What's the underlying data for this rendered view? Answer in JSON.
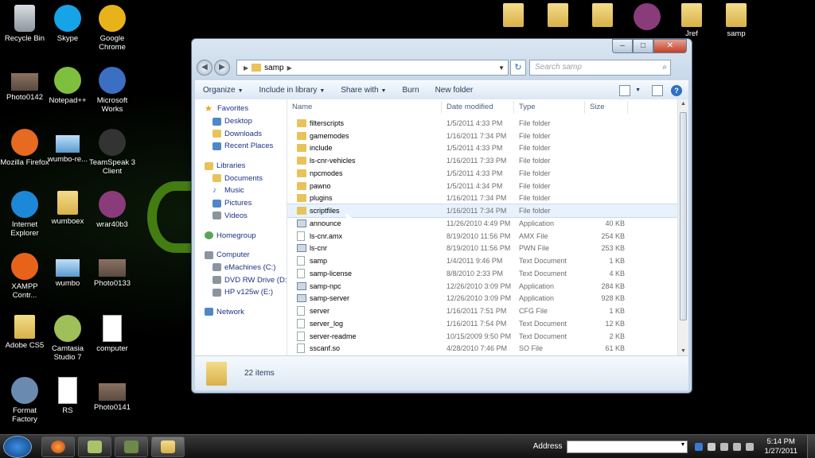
{
  "desktop": {
    "icons_left": [
      {
        "label": "Recycle Bin",
        "icon": "recycle-bin-icon"
      },
      {
        "label": "Skype",
        "icon": "skype-icon"
      },
      {
        "label": "Google Chrome",
        "icon": "chrome-icon"
      },
      {
        "label": "Photo0142",
        "icon": "photo-icon"
      },
      {
        "label": "Notepad++",
        "icon": "notepad-icon"
      },
      {
        "label": "Microsoft Works",
        "icon": "works-icon"
      },
      {
        "label": "Mozilla Firefox",
        "icon": "firefox-icon"
      },
      {
        "label": "wumbo-re...",
        "icon": "wumbo-icon"
      },
      {
        "label": "TeamSpeak 3 Client",
        "icon": "teamspeak-icon"
      },
      {
        "label": "Internet Explorer",
        "icon": "ie-icon"
      },
      {
        "label": "wumboex",
        "icon": "folder-icon"
      },
      {
        "label": "wrar40b3",
        "icon": "winrar-icon"
      },
      {
        "label": "XAMPP Contr...",
        "icon": "xampp-icon"
      },
      {
        "label": "wumbo",
        "icon": "wumbo-icon"
      },
      {
        "label": "Photo0133",
        "icon": "photo-icon"
      },
      {
        "label": "Adobe CS5",
        "icon": "folder-icon"
      },
      {
        "label": "Camtasia Studio 7",
        "icon": "camtasia-icon"
      },
      {
        "label": "computer",
        "icon": "document-icon"
      },
      {
        "label": "Format Factory",
        "icon": "format-factory-icon"
      },
      {
        "label": "RS",
        "icon": "document-icon"
      },
      {
        "label": "Photo0141",
        "icon": "photo-icon"
      }
    ],
    "icons_top_right": [
      {
        "label": "",
        "icon": "folder-icon"
      },
      {
        "label": "",
        "icon": "folder-icon"
      },
      {
        "label": "",
        "icon": "folder-icon"
      },
      {
        "label": "",
        "icon": "winrar-icon"
      },
      {
        "label": "Jref",
        "icon": "folder-icon"
      },
      {
        "label": "samp",
        "icon": "folder-icon"
      }
    ]
  },
  "window": {
    "caption_buttons": {
      "minimize": "–",
      "maximize": "□",
      "close": "✕"
    },
    "breadcrumb": [
      "samp"
    ],
    "search_placeholder": "Search samp",
    "toolbar": {
      "organize": "Organize",
      "include_in_library": "Include in library",
      "share_with": "Share with",
      "burn": "Burn",
      "new_folder": "New folder"
    },
    "nav": {
      "favorites": "Favorites",
      "favorites_items": [
        "Desktop",
        "Downloads",
        "Recent Places"
      ],
      "libraries": "Libraries",
      "libraries_items": [
        "Documents",
        "Music",
        "Pictures",
        "Videos"
      ],
      "homegroup": "Homegroup",
      "computer": "Computer",
      "computer_items": [
        "eMachines (C:)",
        "DVD RW Drive (D:) G",
        "HP v125w (E:)"
      ],
      "network": "Network"
    },
    "columns": {
      "name": "Name",
      "date": "Date modified",
      "type": "Type",
      "size": "Size"
    },
    "files": [
      {
        "name": "filterscripts",
        "date": "1/5/2011 4:33 PM",
        "type": "File folder",
        "size": "",
        "kind": "folder"
      },
      {
        "name": "gamemodes",
        "date": "1/16/2011 7:34 PM",
        "type": "File folder",
        "size": "",
        "kind": "folder"
      },
      {
        "name": "include",
        "date": "1/5/2011 4:33 PM",
        "type": "File folder",
        "size": "",
        "kind": "folder"
      },
      {
        "name": "ls-cnr-vehicles",
        "date": "1/16/2011 7:33 PM",
        "type": "File folder",
        "size": "",
        "kind": "folder"
      },
      {
        "name": "npcmodes",
        "date": "1/5/2011 4:33 PM",
        "type": "File folder",
        "size": "",
        "kind": "folder"
      },
      {
        "name": "pawno",
        "date": "1/5/2011 4:34 PM",
        "type": "File folder",
        "size": "",
        "kind": "folder"
      },
      {
        "name": "plugins",
        "date": "1/16/2011 7:34 PM",
        "type": "File folder",
        "size": "",
        "kind": "folder"
      },
      {
        "name": "scriptfiles",
        "date": "1/16/2011 7:34 PM",
        "type": "File folder",
        "size": "",
        "kind": "folder"
      },
      {
        "name": "announce",
        "date": "11/26/2010 4:49 PM",
        "type": "Application",
        "size": "40 KB",
        "kind": "app"
      },
      {
        "name": "ls-cnr.amx",
        "date": "8/19/2010 11:56 PM",
        "type": "AMX File",
        "size": "254 KB",
        "kind": "doc"
      },
      {
        "name": "ls-cnr",
        "date": "8/19/2010 11:56 PM",
        "type": "PWN File",
        "size": "253 KB",
        "kind": "app"
      },
      {
        "name": "samp",
        "date": "1/4/2011 9:46 PM",
        "type": "Text Document",
        "size": "1 KB",
        "kind": "doc"
      },
      {
        "name": "samp-license",
        "date": "8/8/2010 2:33 PM",
        "type": "Text Document",
        "size": "4 KB",
        "kind": "doc"
      },
      {
        "name": "samp-npc",
        "date": "12/26/2010 3:09 PM",
        "type": "Application",
        "size": "284 KB",
        "kind": "app"
      },
      {
        "name": "samp-server",
        "date": "12/26/2010 3:09 PM",
        "type": "Application",
        "size": "928 KB",
        "kind": "app"
      },
      {
        "name": "server",
        "date": "1/16/2011 7:51 PM",
        "type": "CFG File",
        "size": "1 KB",
        "kind": "doc"
      },
      {
        "name": "server_log",
        "date": "1/16/2011 7:54 PM",
        "type": "Text Document",
        "size": "12 KB",
        "kind": "doc"
      },
      {
        "name": "server-readme",
        "date": "10/15/2009 9:50 PM",
        "type": "Text Document",
        "size": "2 KB",
        "kind": "doc"
      },
      {
        "name": "sscanf.so",
        "date": "4/28/2010 7:46 PM",
        "type": "SO File",
        "size": "61 KB",
        "kind": "doc"
      }
    ],
    "status": "22 items"
  },
  "taskbar": {
    "address_label": "Address",
    "time": "5:14 PM",
    "date": "1/27/2011"
  }
}
